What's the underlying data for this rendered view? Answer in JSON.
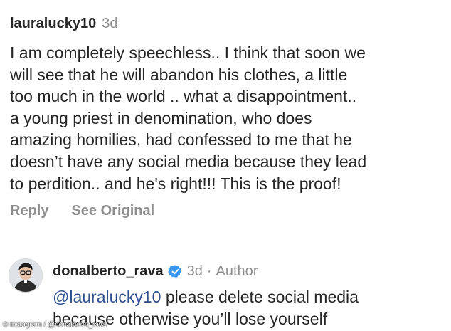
{
  "comment": {
    "username": "lauralucky10",
    "timestamp": "3d",
    "lines": [
      "I am completely speechless.. I think that soon we",
      "will see that he will abandon his clothes, a little",
      "too much in the world .. what a disappointment..",
      "a young priest in denomination, who does",
      "amazing homilies, had confessed to me that he",
      "doesn’t have any social media because they lead",
      "to perdition.. and he's right!!! This is the proof!"
    ],
    "actions": {
      "reply": "Reply",
      "see_original": "See Original"
    }
  },
  "reply": {
    "username": "donalberto_rava",
    "verified_icon": "verified-badge-icon",
    "timestamp": "3d",
    "separator": "·",
    "author_label": "Author",
    "mention": "@lauralucky10",
    "text_line1": " please delete social media",
    "text_line2": "because otherwise you’ll lose yourself"
  },
  "watermark": "© Instagram / @donalberto_rava",
  "colors": {
    "text": "#262626",
    "muted": "#8e8e8e",
    "mention": "#2f4f8f",
    "verified": "#3897f0"
  }
}
